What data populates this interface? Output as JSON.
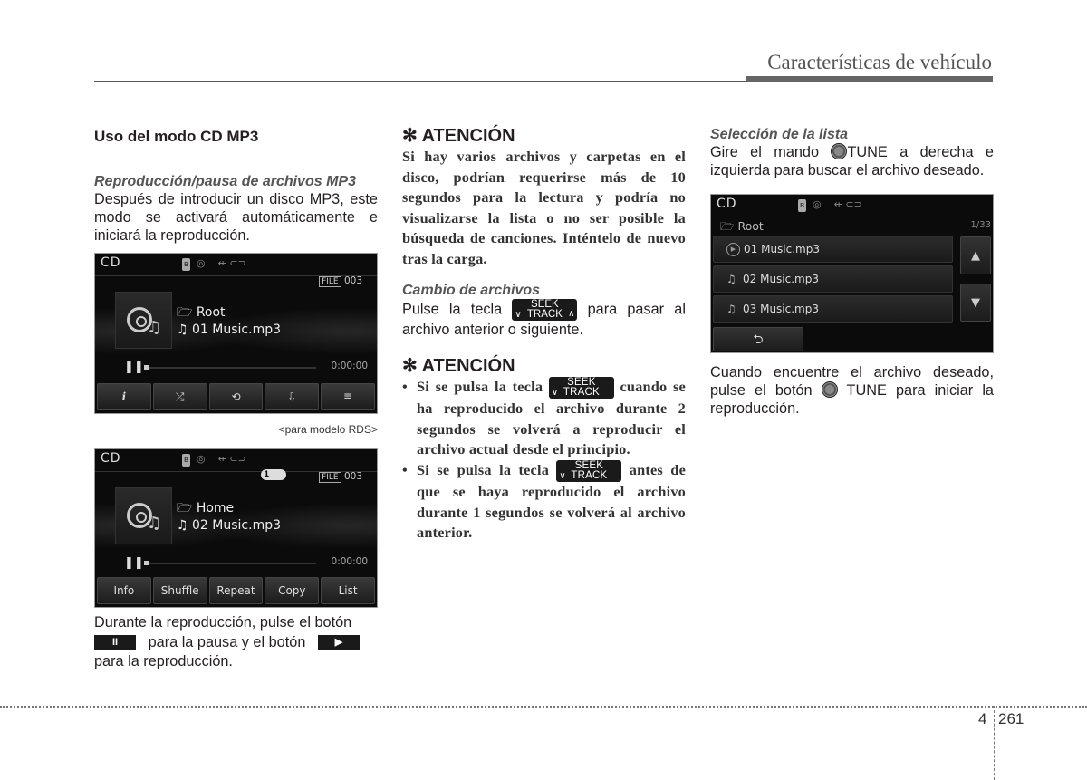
{
  "header": {
    "title": "Características de vehículo"
  },
  "col1": {
    "section_title": "Uso del modo CD MP3",
    "subhead": "Reproducción/pausa de archivos MP3",
    "intro": "Después de introducir un disco MP3, este modo se activará automáticamente e iniciará la reproducción.",
    "screen1": {
      "mode": "CD",
      "file_label": "FILE",
      "file_num": "003",
      "folder": "Root",
      "track": "01 Music.mp3",
      "time": "0:00:00",
      "buttons": [
        "i",
        "⤮",
        "⟲",
        "⇩",
        "≣"
      ]
    },
    "caption": "<para modelo RDS>",
    "screen2": {
      "mode": "CD",
      "repeat_badge": "1",
      "file_label": "FILE",
      "file_num": "003",
      "folder": "Home",
      "track": "02 Music.mp3",
      "time": "0:00:00",
      "buttons": [
        "Info",
        "Shuffle",
        "Repeat",
        "Copy",
        "List"
      ]
    },
    "outro_a": "Durante la reproducción, pulse el botón",
    "outro_b": "para la pausa y el botón",
    "outro_c": "para la reproducción.",
    "pause_key": "II",
    "play_key": "▶"
  },
  "col2": {
    "atencion1_title": "✻ ATENCIÓN",
    "atencion1_text": "Si hay varios archivos y carpetas en el disco, podrían requerirse más de 10 segundos para la lectura y podría no visualizarse la lista o no ser posible la búsqueda de canciones. Inténtelo de nuevo tras la carga.",
    "cambio_subhead": "Cambio de archivos",
    "cambio_a": "Pulse la tecla",
    "cambio_b": "para pasar al archivo anterior o siguiente.",
    "seek_top": "SEEK",
    "seek_bottom": "TRACK",
    "atencion2_title": "✻ ATENCIÓN",
    "bullet1_a": "Si se pulsa la tecla",
    "bullet1_b": "cuando se ha reproducido el archivo durante 2 segundos se volverá a reproducir el archivo actual desde el principio.",
    "bullet2_a": "Si se pulsa la tecla",
    "bullet2_b": "antes de que se haya reproducido el archivo durante 1 segundos se volverá al archivo anterior."
  },
  "col3": {
    "subhead": "Selección de la lista",
    "text1_a": "Gire el mando",
    "text1_b": "TUNE a derecha e izquierda para buscar el archivo deseado.",
    "list_screen": {
      "mode": "CD",
      "path": "Root",
      "count": "1/33",
      "items": [
        "01 Music.mp3",
        "02 Music.mp3",
        "03 Music.mp3"
      ],
      "up": "▲",
      "down": "▼",
      "back": "⮌"
    },
    "text2_a": "Cuando encuentre el archivo deseado, pulse el botón",
    "text2_b": "TUNE para iniciar la reproducción."
  },
  "footer": {
    "chapter": "4",
    "page": "261"
  }
}
